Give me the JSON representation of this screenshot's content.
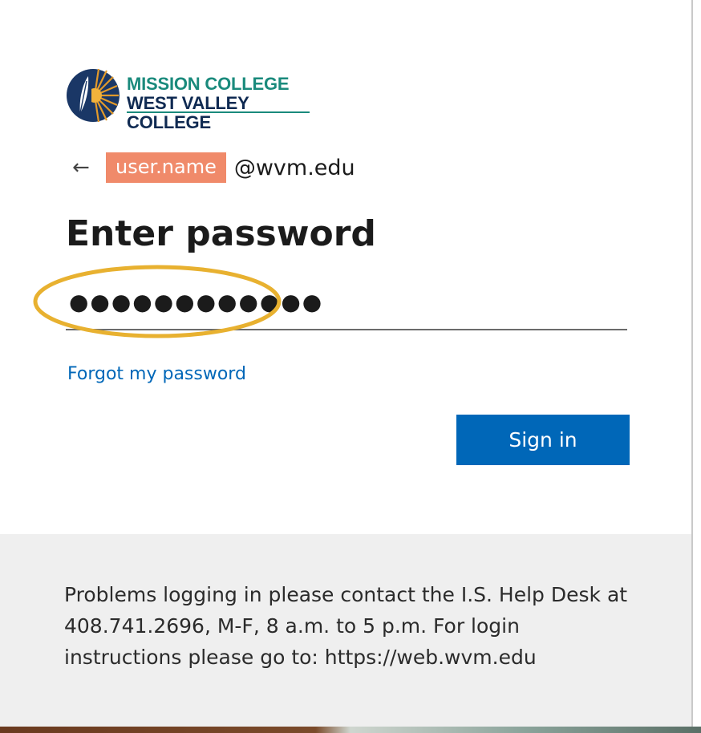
{
  "logo": {
    "line1": "MISSION COLLEGE",
    "line2": "WEST VALLEY COLLEGE",
    "icon": "leaf-sun-emblem-icon"
  },
  "identity": {
    "back_icon": "back-arrow-icon",
    "username": "user.name",
    "domain": "@wvm.edu"
  },
  "page": {
    "title": "Enter password"
  },
  "password_field": {
    "value": "●●●●●●●●●●●●"
  },
  "links": {
    "forgot": "Forgot my password"
  },
  "buttons": {
    "sign_in": "Sign in"
  },
  "footer": {
    "text": "Problems logging in please contact the I.S. Help Desk at 408.741.2696, M-F, 8 a.m. to 5 p.m. For login instructions please go to: https://web.wvm.edu"
  },
  "colors": {
    "accent": "#0067b8",
    "username_chip": "#f08a6a",
    "highlight_ring": "#e8b130",
    "footer_bg": "#efefef"
  }
}
